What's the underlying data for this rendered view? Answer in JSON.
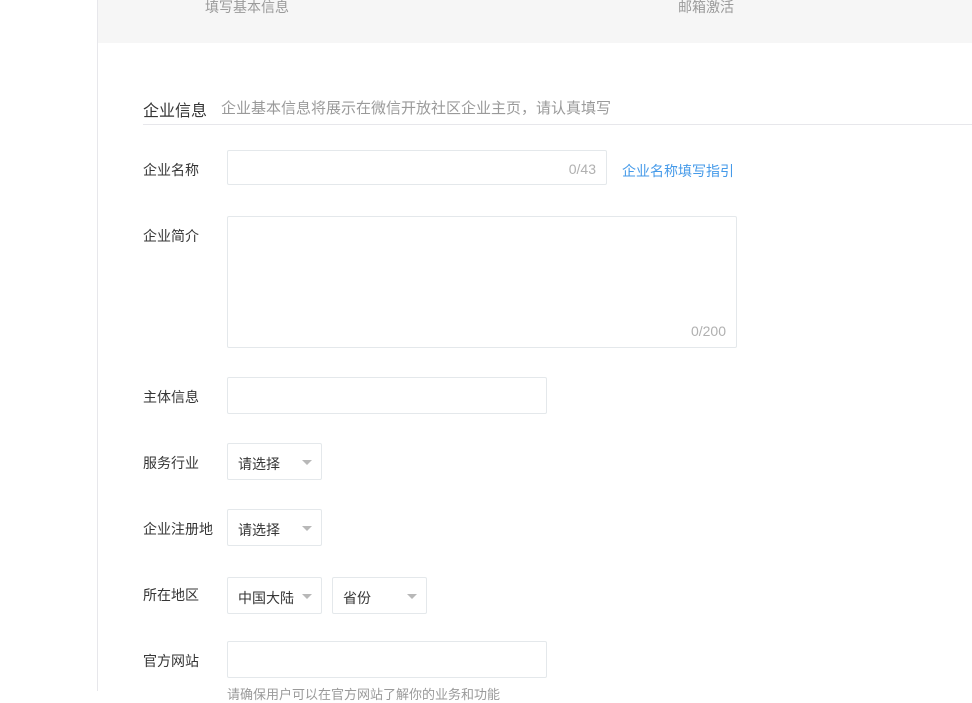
{
  "steps": {
    "step1": "填写基本信息",
    "step2": "邮箱激活"
  },
  "section": {
    "title": "企业信息",
    "description": "企业基本信息将展示在微信开放社区企业主页，请认真填写"
  },
  "form": {
    "company_name": {
      "label": "企业名称",
      "value": "",
      "counter": "0/43",
      "guide_link": "企业名称填写指引"
    },
    "company_intro": {
      "label": "企业简介",
      "value": "",
      "counter": "0/200"
    },
    "entity_info": {
      "label": "主体信息",
      "value": ""
    },
    "service_industry": {
      "label": "服务行业",
      "selected": "请选择"
    },
    "registration_place": {
      "label": "企业注册地",
      "selected": "请选择"
    },
    "region": {
      "label": "所在地区",
      "country_selected": "中国大陆",
      "province_selected": "省份"
    },
    "website": {
      "label": "官方网站",
      "value": "",
      "hint": "请确保用户可以在官方网站了解你的业务和功能"
    }
  },
  "colors": {
    "link": "#459ae9",
    "border": "#e4e8eb",
    "muted_text": "#9a9a9a",
    "header_bg": "#f6f6f6"
  },
  "icons": {
    "select_caret": "caret-down-icon"
  }
}
